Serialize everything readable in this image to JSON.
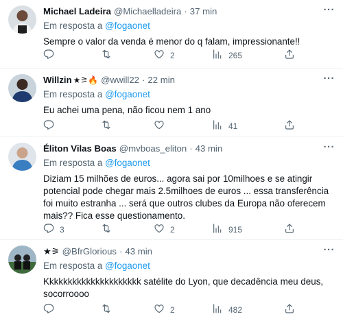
{
  "tweets": [
    {
      "name": "Michael Ladeira",
      "handle": "@Michaelladeira",
      "time": "37 min",
      "reply_prefix": "Em resposta a",
      "reply_target": "@fogaonet",
      "text": "Sempre o valor da venda é menor do q falam, impressionante!!",
      "replies": "",
      "retweets": "",
      "likes": "2",
      "views": "265"
    },
    {
      "name": "Willzin",
      "name_badges": "★⚞🔥",
      "handle": "@wwill22",
      "time": "22 min",
      "reply_prefix": "Em resposta a",
      "reply_target": "@fogaonet",
      "text": "Eu achei uma pena, não ficou nem 1 ano",
      "replies": "",
      "retweets": "",
      "likes": "",
      "views": "41"
    },
    {
      "name": "Éliton Vilas Boas",
      "handle": "@mvboas_eliton",
      "time": "43 min",
      "reply_prefix": "Em resposta a",
      "reply_target": "@fogaonet",
      "text": "Diziam 15 milhões de euros... agora sai por 10milhoes e se atingir potencial pode chegar mais 2.5milhoes de euros ... essa  transferência foi muito estranha ... será que outros clubes da Europa não oferecem mais?? Fica esse questionamento.",
      "replies": "3",
      "retweets": "",
      "likes": "2",
      "views": "915"
    },
    {
      "name": "★⚞",
      "handle": "@BfrGlorious",
      "time": "43 min",
      "reply_prefix": "Em resposta a",
      "reply_target": "@fogaonet",
      "text": "Kkkkkkkkkkkkkkkkkkkkk satélite do Lyon, que decadência meu deus, socorroooo",
      "replies": "",
      "retweets": "",
      "likes": "2",
      "views": "482"
    }
  ],
  "header_separator": "·",
  "more_label": "···",
  "icons": [
    "reply-icon",
    "retweet-icon",
    "like-icon",
    "views-icon",
    "share-icon"
  ],
  "colors": {
    "link": "#1d9bf0",
    "muted": "#536471",
    "text": "#0f1419",
    "divider": "#eff3f4"
  }
}
